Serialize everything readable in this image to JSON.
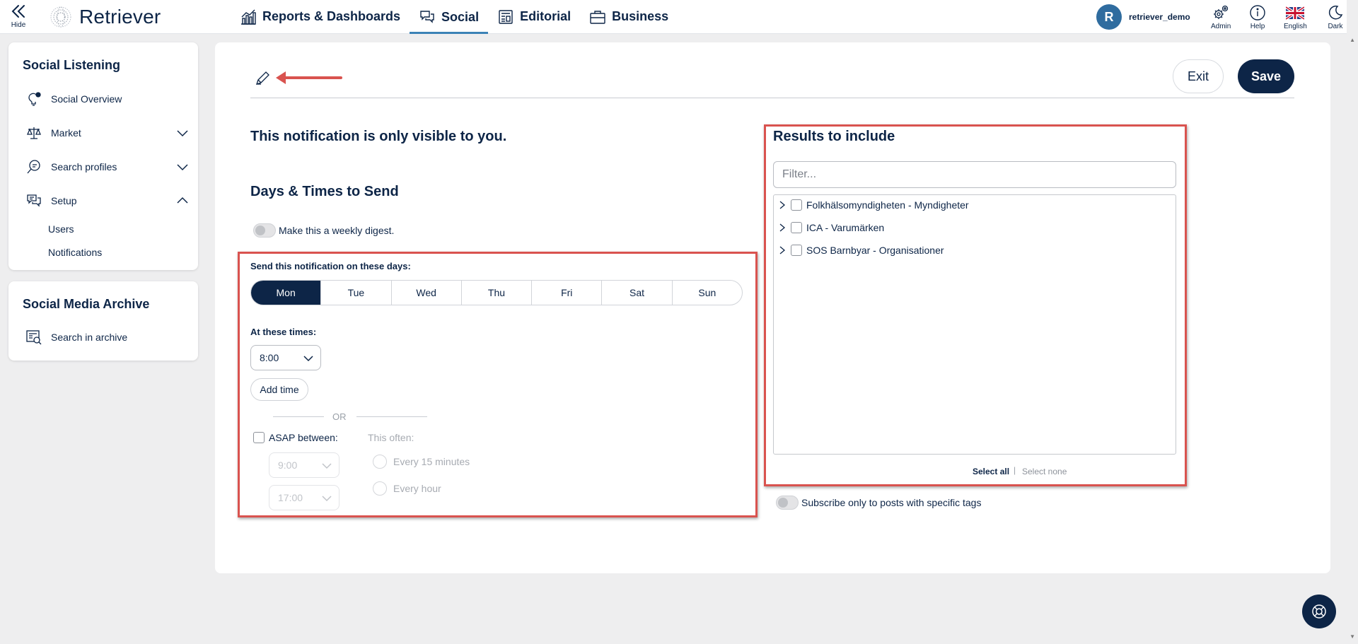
{
  "header": {
    "hide_label": "Hide",
    "logo_text": "Retriever",
    "nav": [
      {
        "label": "Reports & Dashboards",
        "icon": "bar-chart-icon"
      },
      {
        "label": "Social",
        "icon": "chat-bubbles-icon",
        "active": true
      },
      {
        "label": "Editorial",
        "icon": "newspaper-icon"
      },
      {
        "label": "Business",
        "icon": "briefcase-icon"
      }
    ],
    "user": {
      "initial": "R",
      "name": "retriever_demo"
    },
    "tools": {
      "admin": "Admin",
      "help": "Help",
      "language": "English",
      "theme": "Dark"
    }
  },
  "sidebar": {
    "social_listening": {
      "title": "Social Listening",
      "items": [
        {
          "label": "Social Overview",
          "icon": "lightbulb-icon"
        },
        {
          "label": "Market",
          "icon": "scales-icon",
          "expandable": "collapsed"
        },
        {
          "label": "Search profiles",
          "icon": "search-chat-icon",
          "expandable": "collapsed"
        },
        {
          "label": "Setup",
          "icon": "chat-settings-icon",
          "expandable": "expanded"
        }
      ],
      "sub_items": [
        "Users",
        "Notifications"
      ]
    },
    "archive": {
      "title": "Social Media Archive",
      "items": [
        {
          "label": "Search in archive",
          "icon": "archive-search-icon"
        }
      ]
    }
  },
  "form": {
    "exit_label": "Exit",
    "save_label": "Save",
    "visibility_text": "This notification is only visible to you.",
    "days_heading": "Days & Times to Send",
    "weekly_digest_label": "Make this a weekly digest.",
    "send_days_label": "Send this notification on these days:",
    "days": [
      {
        "label": "Mon",
        "selected": true
      },
      {
        "label": "Tue",
        "selected": false
      },
      {
        "label": "Wed",
        "selected": false
      },
      {
        "label": "Thu",
        "selected": false
      },
      {
        "label": "Fri",
        "selected": false
      },
      {
        "label": "Sat",
        "selected": false
      },
      {
        "label": "Sun",
        "selected": false
      }
    ],
    "times_label": "At these times:",
    "time_value": "8:00",
    "add_time_label": "Add time",
    "or_text": "OR",
    "asap_label": "ASAP between:",
    "asap_start": "9:00",
    "asap_end": "17:00",
    "often_label": "This often:",
    "often_options": [
      "Every 15 minutes",
      "Every hour"
    ]
  },
  "results": {
    "heading": "Results to include",
    "filter_placeholder": "Filter...",
    "items": [
      "Folkhälsomyndigheten - Myndigheter",
      "ICA - Varumärken",
      "SOS Barnbyar - Organisationer"
    ],
    "select_all": "Select all",
    "separator": "|",
    "select_none": "Select none",
    "tags_toggle_label": "Subscribe only to posts with specific tags"
  },
  "colors": {
    "navy": "#0d2547",
    "accent": "#3b82b6",
    "highlight": "#d9534f",
    "page_bg": "#eeeeef"
  }
}
